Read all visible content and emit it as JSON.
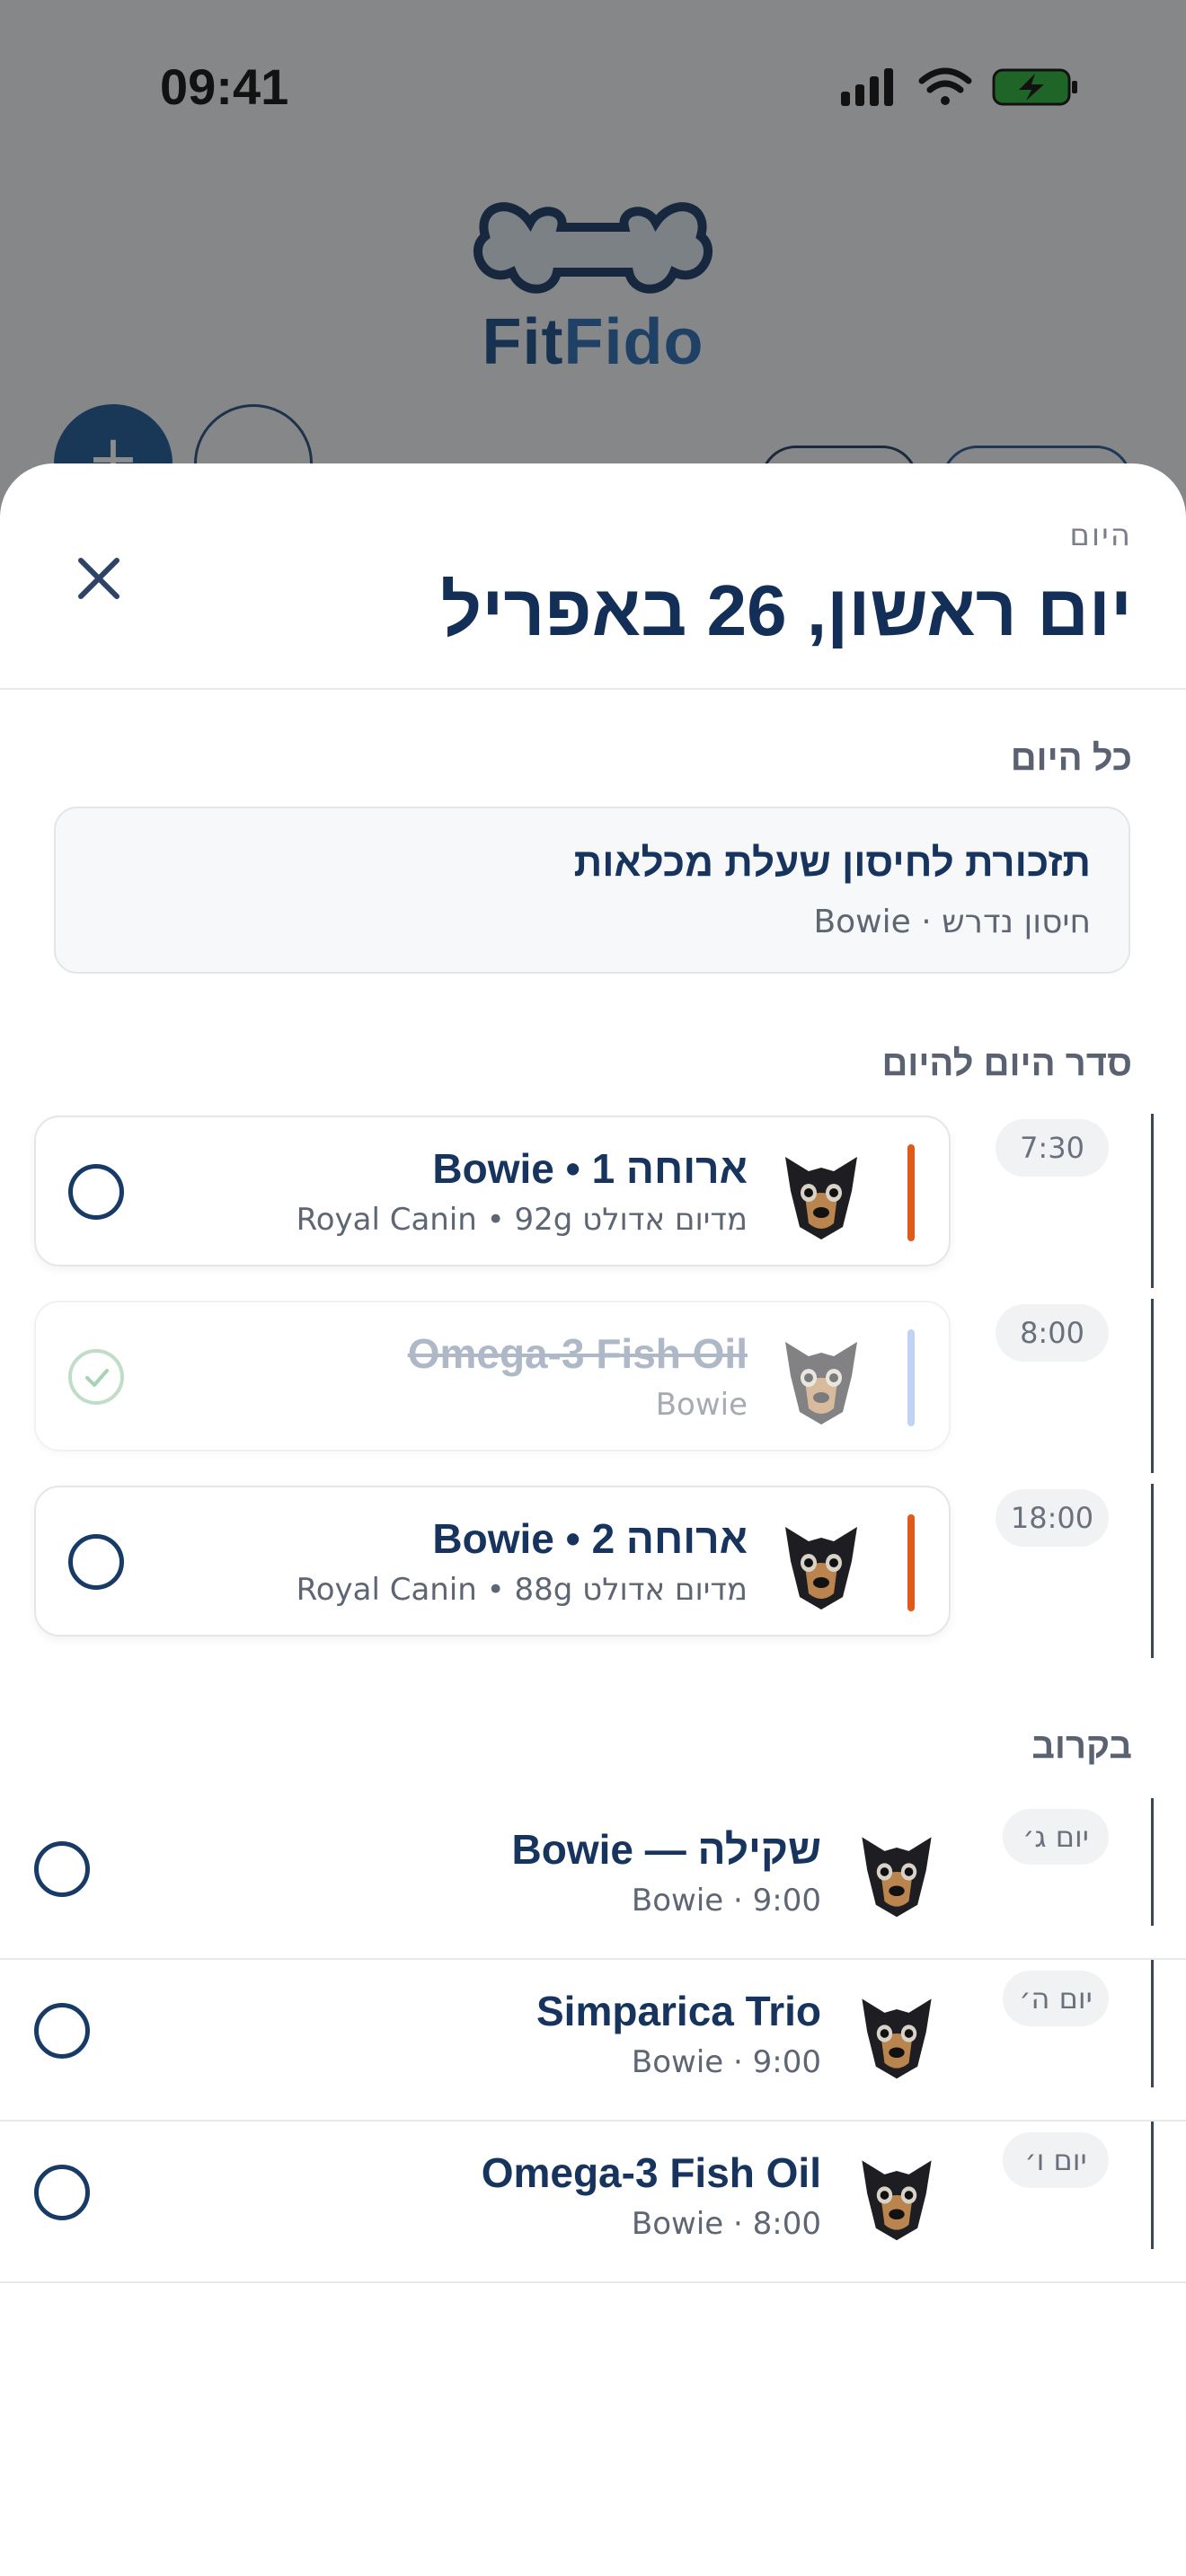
{
  "status_bar": {
    "time": "09:41"
  },
  "app": {
    "logo_fit": "Fit",
    "logo_fido": "Fido"
  },
  "sheet": {
    "kicker": "היום",
    "title": "יום ראשון, 26 באפריל"
  },
  "all_day": {
    "label": "כל היום",
    "reminder_title": "תזכורת לחיסון שעלת מכלאות",
    "reminder_sub": "חיסון נדרש · Bowie"
  },
  "schedule": {
    "label": "סדר היום להיום",
    "events": [
      {
        "time": "7:30",
        "title": "ארוחה 1 • Bowie",
        "subtitle": "מדיום אדולט Royal Canin • 92g",
        "accent": "#e05a1a",
        "done": false
      },
      {
        "time": "8:00",
        "title": "Omega-3 Fish Oil",
        "subtitle": "Bowie",
        "accent": "#8fb0ea",
        "done": true
      },
      {
        "time": "18:00",
        "title": "ארוחה 2 • Bowie",
        "subtitle": "מדיום אדולט Royal Canin • 88g",
        "accent": "#e05a1a",
        "done": false
      }
    ]
  },
  "upcoming": {
    "label": "בקרוב",
    "items": [
      {
        "day": "יום ג׳",
        "title": "שקילה — Bowie",
        "subtitle": "Bowie · 9:00"
      },
      {
        "day": "יום ה׳",
        "title": "Simparica Trio",
        "subtitle": "Bowie · 9:00"
      },
      {
        "day": "יום ו׳",
        "title": "Omega-3 Fish Oil",
        "subtitle": "Bowie · 8:00"
      }
    ]
  },
  "icons": {
    "close": "close-icon",
    "check": "check-icon",
    "avatar": "dog-avatar",
    "signal": "cellular-signal-icon",
    "wifi": "wifi-icon",
    "battery": "battery-charging-icon"
  }
}
